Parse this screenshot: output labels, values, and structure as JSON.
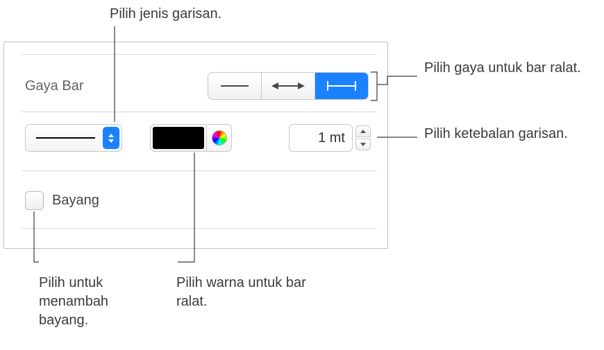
{
  "callouts": {
    "line_type": "Pilih jenis garisan.",
    "bar_style": "Pilih gaya untuk bar ralat.",
    "thickness": "Pilih ketebalan garisan.",
    "shadow": "Pilih untuk menambah bayang.",
    "color": "Pilih warna untuk bar ralat."
  },
  "panel": {
    "section_label": "Gaya Bar",
    "thickness_value": "1 mt",
    "shadow_label": "Bayang",
    "line_color": "#000000",
    "selected_segment": 2
  },
  "icons": {
    "chevron_updown": "chevron-updown-icon",
    "color_wheel": "color-wheel-icon"
  }
}
